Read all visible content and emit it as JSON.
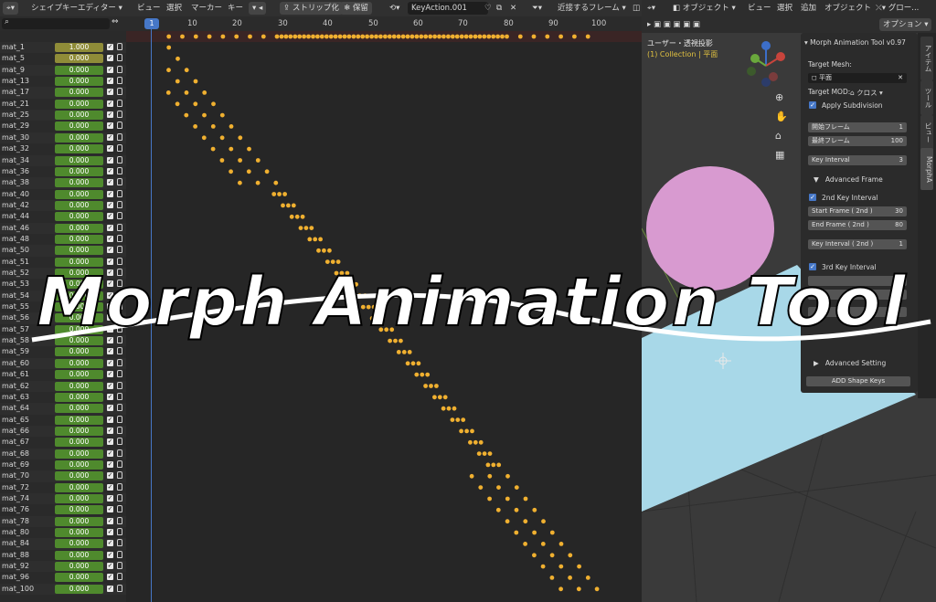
{
  "dope_header": {
    "editor_label": "シェイプキーエディター",
    "menu": [
      "ビュー",
      "選択",
      "マーカー",
      "キー"
    ],
    "strip_label": "ストリップ化",
    "keep_label": "保留",
    "action_name": "KeyAction.001",
    "snap_label": "近接するフレーム"
  },
  "ruler": {
    "current_frame": "1",
    "ticks": [
      "10",
      "20",
      "30",
      "40",
      "50",
      "60",
      "70",
      "80",
      "90",
      "100"
    ]
  },
  "summary_label": "概要",
  "channels": [
    {
      "name": "mat_1",
      "value": "1.000",
      "hi": true
    },
    {
      "name": "mat_5",
      "value": "0.000",
      "hi": true
    },
    {
      "name": "mat_9",
      "value": "0.000"
    },
    {
      "name": "mat_13",
      "value": "0.000"
    },
    {
      "name": "mat_17",
      "value": "0.000"
    },
    {
      "name": "mat_21",
      "value": "0.000"
    },
    {
      "name": "mat_25",
      "value": "0.000"
    },
    {
      "name": "mat_29",
      "value": "0.000"
    },
    {
      "name": "mat_30",
      "value": "0.000"
    },
    {
      "name": "mat_32",
      "value": "0.000"
    },
    {
      "name": "mat_34",
      "value": "0.000"
    },
    {
      "name": "mat_36",
      "value": "0.000"
    },
    {
      "name": "mat_38",
      "value": "0.000"
    },
    {
      "name": "mat_40",
      "value": "0.000"
    },
    {
      "name": "mat_42",
      "value": "0.000"
    },
    {
      "name": "mat_44",
      "value": "0.000"
    },
    {
      "name": "mat_46",
      "value": "0.000"
    },
    {
      "name": "mat_48",
      "value": "0.000"
    },
    {
      "name": "mat_50",
      "value": "0.000"
    },
    {
      "name": "mat_51",
      "value": "0.000"
    },
    {
      "name": "mat_52",
      "value": "0.000"
    },
    {
      "name": "mat_53",
      "value": "0.000"
    },
    {
      "name": "mat_54",
      "value": "0.000"
    },
    {
      "name": "mat_55",
      "value": "0.000"
    },
    {
      "name": "mat_56",
      "value": "0.000"
    },
    {
      "name": "mat_57",
      "value": "0.000"
    },
    {
      "name": "mat_58",
      "value": "0.000"
    },
    {
      "name": "mat_59",
      "value": "0.000"
    },
    {
      "name": "mat_60",
      "value": "0.000"
    },
    {
      "name": "mat_61",
      "value": "0.000"
    },
    {
      "name": "mat_62",
      "value": "0.000"
    },
    {
      "name": "mat_63",
      "value": "0.000"
    },
    {
      "name": "mat_64",
      "value": "0.000"
    },
    {
      "name": "mat_65",
      "value": "0.000"
    },
    {
      "name": "mat_66",
      "value": "0.000"
    },
    {
      "name": "mat_67",
      "value": "0.000"
    },
    {
      "name": "mat_68",
      "value": "0.000"
    },
    {
      "name": "mat_69",
      "value": "0.000"
    },
    {
      "name": "mat_70",
      "value": "0.000"
    },
    {
      "name": "mat_72",
      "value": "0.000"
    },
    {
      "name": "mat_74",
      "value": "0.000"
    },
    {
      "name": "mat_76",
      "value": "0.000"
    },
    {
      "name": "mat_78",
      "value": "0.000"
    },
    {
      "name": "mat_80",
      "value": "0.000"
    },
    {
      "name": "mat_84",
      "value": "0.000"
    },
    {
      "name": "mat_88",
      "value": "0.000"
    },
    {
      "name": "mat_92",
      "value": "0.000"
    },
    {
      "name": "mat_96",
      "value": "0.000"
    },
    {
      "name": "mat_100",
      "value": "0.000"
    }
  ],
  "viewport": {
    "mode_label": "オブジェクト",
    "menu": [
      "ビュー",
      "選択",
      "追加",
      "オブジェクト"
    ],
    "global_label": "グロー...",
    "options_label": "オプション",
    "view_title": "ユーザー・透視投影",
    "collection": "(1) Collection | 平面"
  },
  "panel": {
    "title": "Morph Animation Tool v0.97",
    "target_mesh_label": "Target Mesh:",
    "target_mesh_value": "平面",
    "target_mod_label": "Target MOD:",
    "target_mod_value": "クロス",
    "apply_subdivision": "Apply Subdivision",
    "start_frame_label": "開始フレーム",
    "start_frame_value": "1",
    "end_frame_label": "最終フレーム",
    "end_frame_value": "100",
    "key_interval_label": "Key Interval",
    "key_interval_value": "3",
    "advanced_frame": "Advanced Frame",
    "second_key_interval": "2nd Key Interval",
    "start_frame_2nd_label": "Start Frame ( 2nd )",
    "start_frame_2nd_value": "30",
    "end_frame_2nd_label": "End Frame ( 2nd )",
    "end_frame_2nd_value": "80",
    "key_interval_2nd_label": "Key Interval ( 2nd )",
    "key_interval_2nd_value": "1",
    "third_key_interval": "3rd Key Interval",
    "advanced_setting": "Advanced Setting",
    "add_button": "ADD Shape Keys"
  },
  "side_tabs": [
    "アイテム",
    "ツール",
    "ビュー",
    "MorphA"
  ],
  "overlay_title": "Morph Animation Tool",
  "colors": {
    "key": "#f0b030",
    "accent": "#4677c7",
    "value_green": "#4f8a2d",
    "sphere": "#d89ad0",
    "plane": "#a8d8e8"
  }
}
